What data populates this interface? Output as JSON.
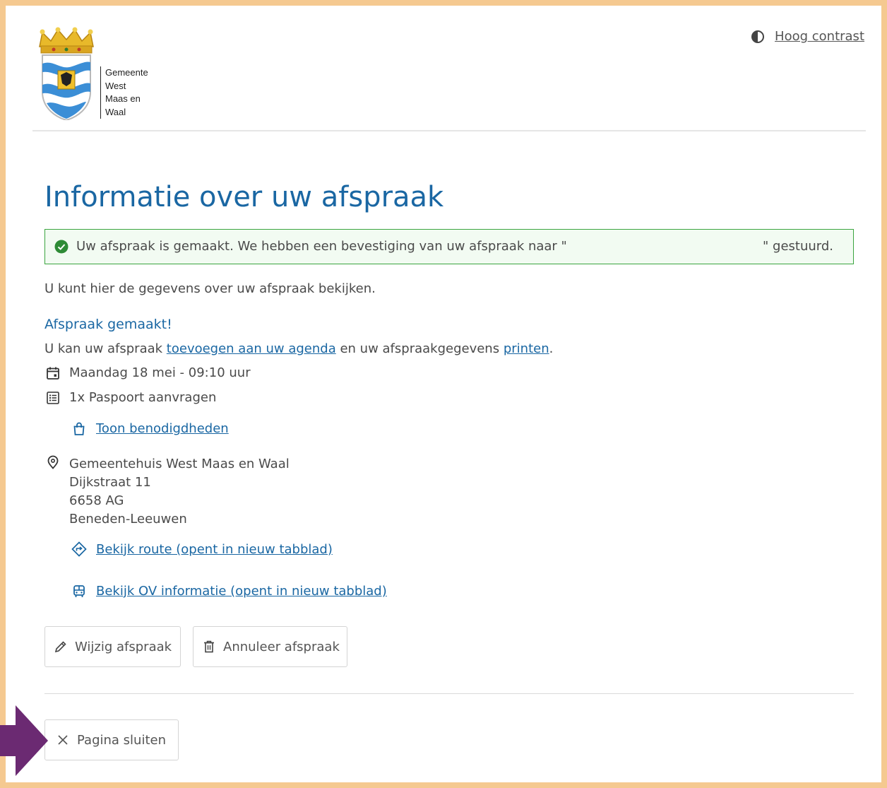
{
  "header": {
    "municipality_lines": [
      "Gemeente",
      "West",
      "Maas en",
      "Waal"
    ],
    "contrast_label": "Hoog contrast"
  },
  "page": {
    "title": "Informatie over uw afspraak",
    "success_message_part1": "Uw afspraak is gemaakt. We hebben een bevestiging van uw afspraak naar \"",
    "success_message_part2": "\" gestuurd.",
    "intro": "U kunt hier de gegevens over uw afspraak bekijken.",
    "subtitle": "Afspraak gemaakt!",
    "action_prefix": "U kan uw afspraak ",
    "agenda_link": "toevoegen aan uw agenda",
    "action_middle": " en uw afspraakgegevens ",
    "print_link": "printen",
    "action_suffix": "."
  },
  "appointment": {
    "datetime": "Maandag 18 mei - 09:10 uur",
    "product": "1x Paspoort aanvragen",
    "requirements_link": "Toon benodigdheden",
    "location": {
      "name": "Gemeentehuis West Maas en Waal",
      "street": "Dijkstraat 11",
      "postcode": "6658 AG",
      "city": "Beneden-Leeuwen"
    },
    "route_link": "Bekijk route (opent in nieuw tabblad)",
    "ov_link": "Bekijk OV informatie (opent in nieuw tabblad)"
  },
  "buttons": {
    "edit": "Wijzig afspraak",
    "cancel": "Annuleer afspraak",
    "close": "Pagina sluiten"
  },
  "colors": {
    "accent": "#1a67a3",
    "success_border": "#3aa53f",
    "frame": "#f5c990",
    "pointer_arrow": "#6b2a72"
  },
  "icons": {
    "contrast": "half-circle-icon",
    "success": "check-circle-icon",
    "date": "calendar-icon",
    "product": "list-icon",
    "requirements": "bag-icon",
    "location": "map-pin-icon",
    "route": "route-diamond-icon",
    "ov": "bus-icon",
    "edit": "pencil-icon",
    "cancel": "trash-icon",
    "close": "close-icon"
  }
}
